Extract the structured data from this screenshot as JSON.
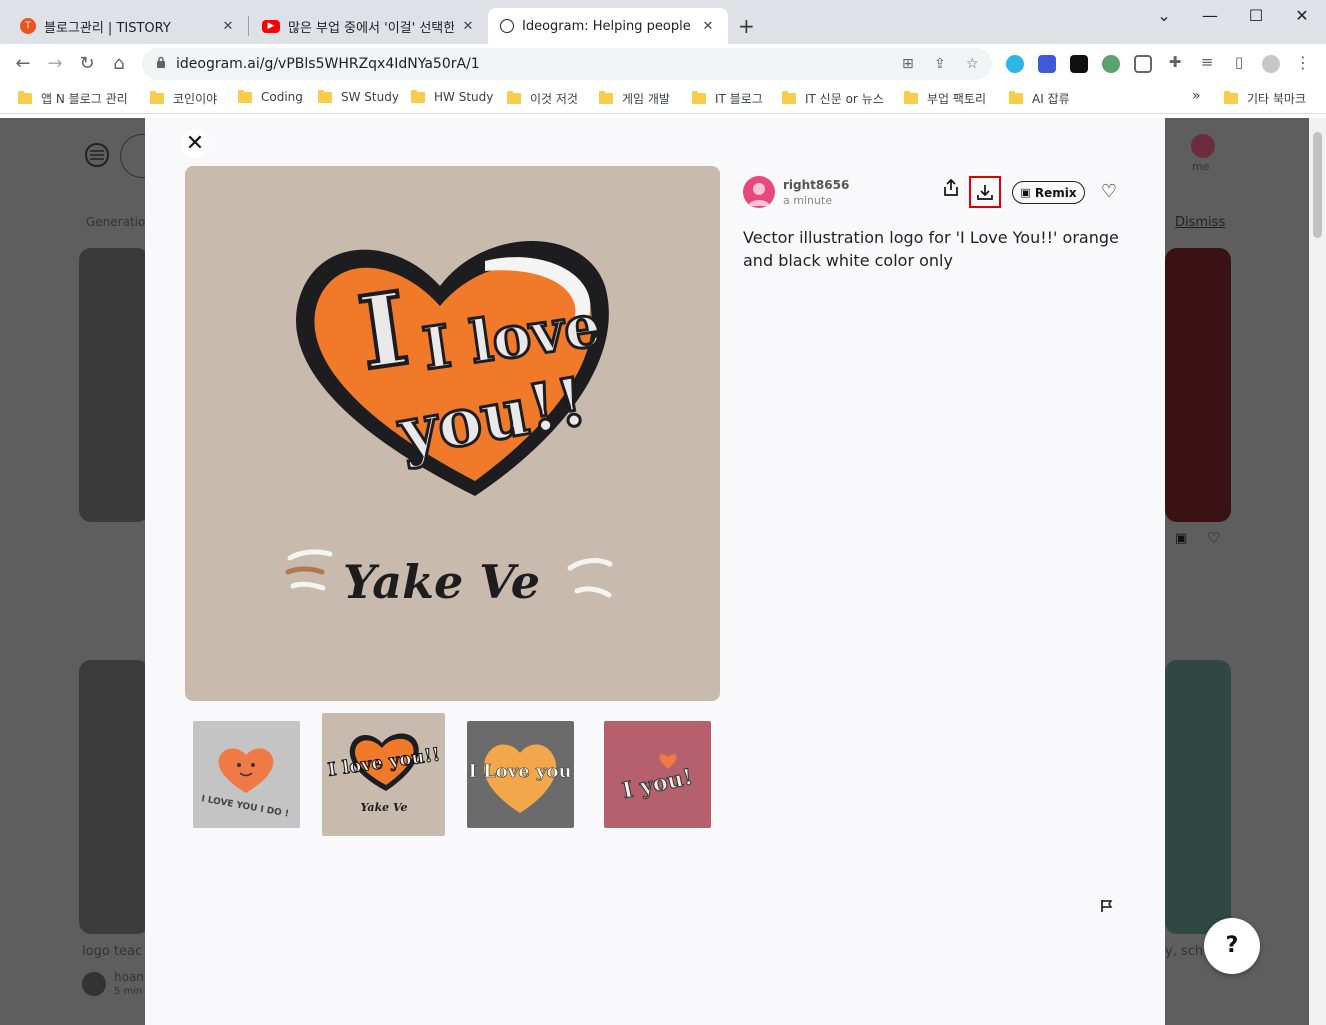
{
  "browser": {
    "tabs": [
      {
        "title": "블로그관리 | TISTORY",
        "favicon": "tistory-icon",
        "color": "#eb531f"
      },
      {
        "title": "많은 부업 중에서 '이걸' 선택한 ",
        "favicon": "youtube-icon",
        "color": "#ff0000"
      },
      {
        "title": "Ideogram: Helping people beco",
        "favicon": "ideogram-icon",
        "color": "#222222"
      }
    ],
    "url": "ideogram.ai/g/vPBls5WHRZqx4IdNYa50rA/1",
    "bookmarks": [
      "앱 N 블로그 관리",
      "코인이야",
      "Coding",
      "SW Study",
      "HW Study",
      "이것 저것",
      "게임 개발",
      "IT 블로그",
      "IT 신문 or 뉴스",
      "부업 팩토리",
      "AI 잡류"
    ],
    "more_bookmarks": "»",
    "other_bookmarks": "기타 북마크"
  },
  "background": {
    "nav_item": "Generatio",
    "dismiss": "Dismiss",
    "profile_label": "me",
    "card_caption": "logo teac",
    "card_author": "hoan",
    "card_time": "5 min",
    "card_caption_right": "y, sch"
  },
  "modal": {
    "author": {
      "name": "right8656",
      "time": "a minute"
    },
    "remix_label": "Remix",
    "prompt": "Vector illustration logo for 'I Love You!!' orange and black white color only",
    "main_image": {
      "line1": "I love",
      "line2": "you!!",
      "signature": "Yake Ve"
    },
    "thumbnails": [
      {
        "text": "I LOVE YOU I DO !",
        "bg": "#c4c4c4"
      },
      {
        "text": "I love you!!",
        "bg": "#c8bbae"
      },
      {
        "text": "I Love you",
        "bg": "#6b6b6b"
      },
      {
        "text": "I you!",
        "bg": "#b5606c"
      }
    ]
  },
  "help_label": "?",
  "colors": {
    "accent_orange": "#f07a2a",
    "download_highlight": "#e00000"
  }
}
